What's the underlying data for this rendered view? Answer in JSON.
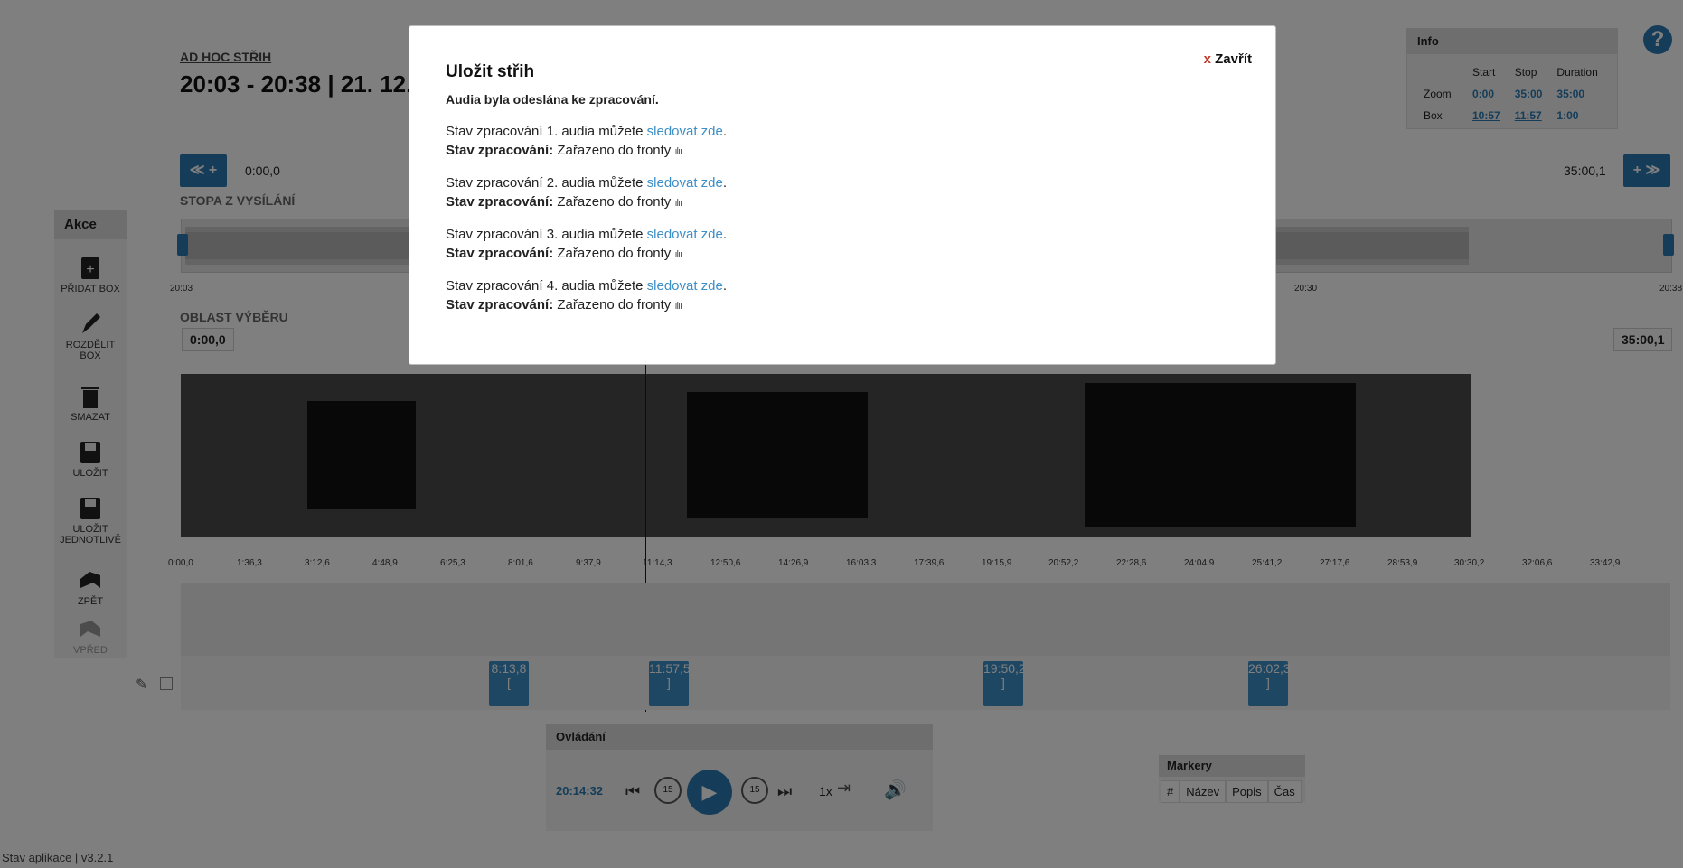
{
  "header": {
    "subtitle": "AD HOC STŘIH",
    "title": "20:03 - 20:38 | 21. 12. |"
  },
  "help": {
    "label": "?"
  },
  "info": {
    "title": "Info",
    "columns": [
      "Start",
      "Stop",
      "Duration"
    ],
    "rows": [
      {
        "label": "Zoom",
        "start": "0:00",
        "stop": "35:00",
        "duration": "35:00"
      },
      {
        "label": "Box",
        "start": "10:57",
        "stop": "11:57",
        "duration": "1:00"
      }
    ]
  },
  "nav": {
    "left_time": "0:00,0",
    "right_time": "35:00,1",
    "left_btn": "≪ +",
    "right_btn": "+ ≫"
  },
  "overview": {
    "label": "STOPA Z VYSÍLÁNÍ",
    "ticks": [
      "20:03",
      "20:30",
      "20:38"
    ]
  },
  "selection": {
    "label": "OBLAST VÝBĚRU",
    "start_value": "0:00,0",
    "end_value": "35:00,1"
  },
  "sidebar": {
    "title": "Akce",
    "items": [
      {
        "label": "PŘIDAT BOX",
        "icon": "add-box-icon"
      },
      {
        "label": "ROZDĚLIT BOX",
        "icon": "pencil-icon"
      },
      {
        "label": "SMAZAT",
        "icon": "trash-icon"
      },
      {
        "label": "ULOŽIT",
        "icon": "save-icon"
      },
      {
        "label": "ULOŽIT JEDNOTLIVĚ",
        "icon": "save-individually-icon"
      },
      {
        "label": "ZPĚT",
        "icon": "undo-icon"
      },
      {
        "label": "VPŘED",
        "icon": "redo-icon"
      }
    ]
  },
  "ruler": {
    "ticks": [
      "0:00,0",
      "1:36,3",
      "3:12,6",
      "4:48,9",
      "6:25,3",
      "8:01,6",
      "9:37,9",
      "11:14,3",
      "12:50,6",
      "14:26,9",
      "16:03,3",
      "17:39,6",
      "19:15,9",
      "20:52,2",
      "22:28,6",
      "24:04,9",
      "25:41,2",
      "27:17,6",
      "28:53,9",
      "30:30,2",
      "32:06,6",
      "33:42,9"
    ]
  },
  "markers": [
    {
      "time": "8:13,8",
      "bracket": "["
    },
    {
      "time": "11:57,5",
      "bracket": "]"
    },
    {
      "time": "19:50,2",
      "bracket": "]"
    },
    {
      "time": "26:02,3",
      "bracket": "]"
    }
  ],
  "controls": {
    "title": "Ovládání",
    "current_time": "20:14:32",
    "speed": "1x",
    "back_label": "15",
    "forward_label": "15"
  },
  "markers_panel": {
    "title": "Markery",
    "columns": [
      "#",
      "Název",
      "Popis",
      "Čas"
    ]
  },
  "footer": {
    "version": "Stav aplikace | v3.2.1"
  },
  "modal": {
    "title": "Uložit střih",
    "close_label": "Zavřít",
    "close_x": "x",
    "message": "Audia byla odeslána ke zpracování.",
    "items": [
      {
        "prefix": "Stav zpracování 1. audia můžete ",
        "link": "sledovat zde",
        "suffix": ".",
        "status_label": "Stav zpracování:",
        "status_value": "Zařazeno do fronty"
      },
      {
        "prefix": "Stav zpracování 2. audia můžete ",
        "link": "sledovat zde",
        "suffix": ".",
        "status_label": "Stav zpracování:",
        "status_value": "Zařazeno do fronty"
      },
      {
        "prefix": "Stav zpracování 3. audia můžete ",
        "link": "sledovat zde",
        "suffix": ".",
        "status_label": "Stav zpracování:",
        "status_value": "Zařazeno do fronty"
      },
      {
        "prefix": "Stav zpracování 4. audia můžete ",
        "link": "sledovat zde",
        "suffix": ".",
        "status_label": "Stav zpracování:",
        "status_value": "Zařazeno do fronty"
      }
    ]
  }
}
